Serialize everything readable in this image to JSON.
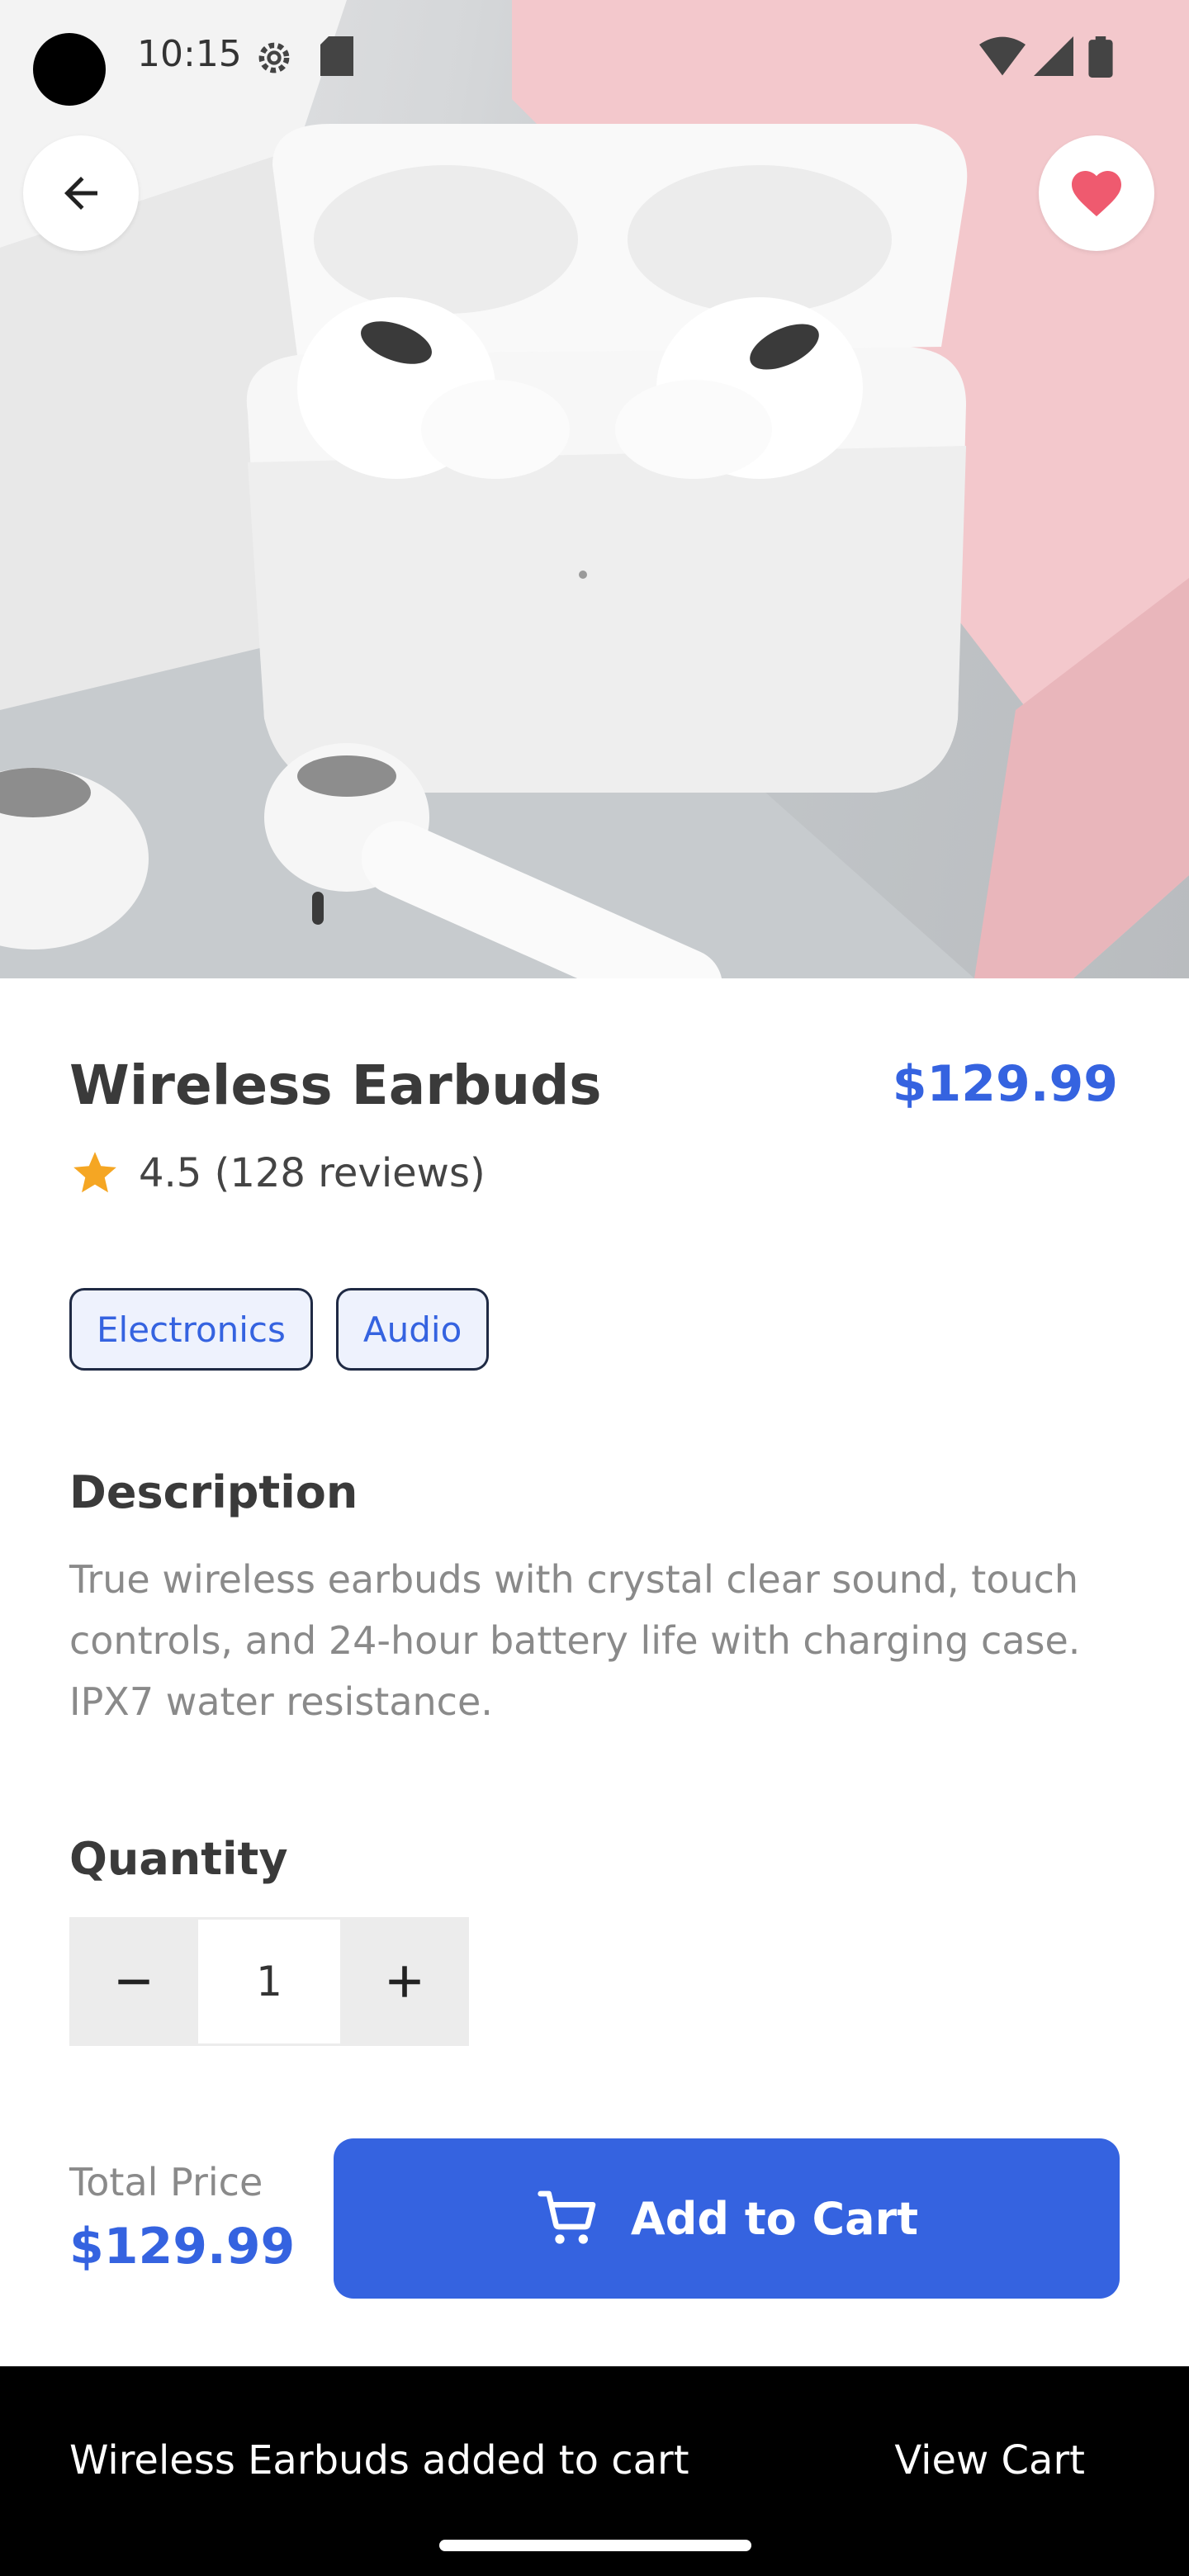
{
  "status_bar": {
    "time": "10:15"
  },
  "product": {
    "title": "Wireless Earbuds",
    "price": "$129.99",
    "rating": "4.5 (128 reviews)",
    "tags": [
      "Electronics",
      "Audio"
    ],
    "description_heading": "Description",
    "description": "True wireless earbuds with crystal clear sound, touch controls, and 24-hour battery life with charging case. IPX7 water resistance."
  },
  "quantity": {
    "heading": "Quantity",
    "value": "1"
  },
  "total": {
    "label": "Total Price",
    "value": "$129.99"
  },
  "actions": {
    "add_to_cart": "Add to Cart"
  },
  "snackbar": {
    "message": "Wireless Earbuds added to cart",
    "action": "View Cart"
  },
  "colors": {
    "accent": "#3563e0",
    "heart": "#ef5a6f",
    "star": "#f5a623"
  },
  "icons": [
    "back-arrow-icon",
    "heart-icon",
    "star-icon",
    "minus-icon",
    "plus-icon",
    "cart-icon"
  ]
}
